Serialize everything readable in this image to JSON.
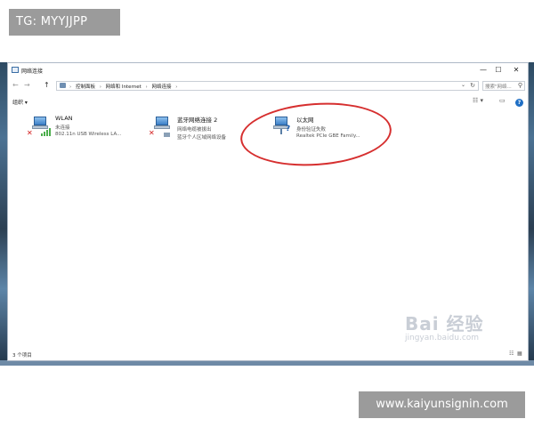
{
  "watermarks": {
    "top_left": "TG: MYYJJPP",
    "bottom_right": "www.kaiyunsignin.com",
    "baidu_logo": "Bai 经验",
    "baidu_url": "jingyan.baidu.com"
  },
  "window": {
    "title": "网络连接",
    "minimize": "—",
    "maximize": "☐",
    "close": "✕"
  },
  "nav": {
    "back": "←",
    "forward": "→",
    "up": "↑"
  },
  "address": {
    "crumbs": [
      "控制面板",
      "网络和 Internet",
      "网络连接"
    ],
    "separator": "›",
    "dropdown": "⌄",
    "refresh": "↻"
  },
  "search": {
    "placeholder": "搜索\"网络...",
    "icon": "⚲"
  },
  "toolbar": {
    "organize": "组织 ▾",
    "view": "☷ ▾",
    "pane": "▭",
    "help": "?"
  },
  "connections": [
    {
      "name": "WLAN",
      "status": "未连接",
      "device": "802.11n USB Wireless LA...",
      "icon": "wifi-icon"
    },
    {
      "name": "蓝牙网络连接 2",
      "status": "网络电缆被拔出",
      "device": "蓝牙个人区域网络设备",
      "icon": "bluetooth-icon"
    },
    {
      "name": "以太网",
      "status": "身份验证失败",
      "device": "Realtek PCIe GBE Family...",
      "icon": "ethernet-icon"
    }
  ],
  "statusbar": {
    "count": "3 个项目",
    "details_view": "☷",
    "icons_view": "▦"
  },
  "colors": {
    "annotation_circle": "#d62f2f",
    "error_x": "#d21b1b",
    "signal": "#4cae4c"
  }
}
